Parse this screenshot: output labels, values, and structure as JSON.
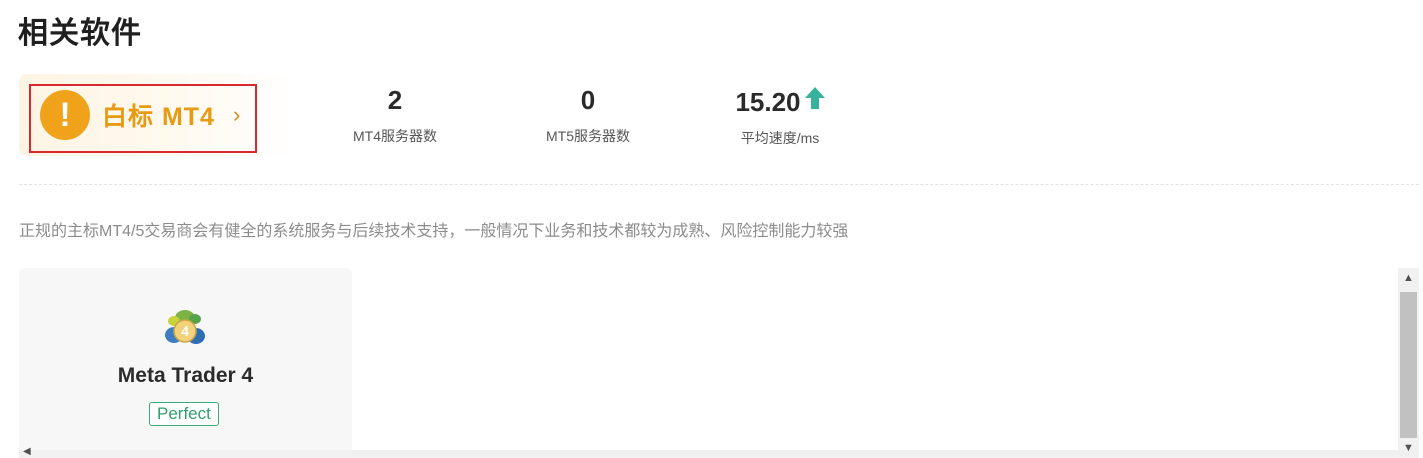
{
  "section": {
    "title": "相关软件"
  },
  "license": {
    "label": "白标 MT4",
    "icon": "warning-icon",
    "chevron": "chevron-right-icon",
    "highlight_color": "#d9292f",
    "accent": "#f0a21a"
  },
  "stats": [
    {
      "value": "2",
      "label": "MT4服务器数"
    },
    {
      "value": "0",
      "label": "MT5服务器数"
    },
    {
      "value": "15.20",
      "label": "平均速度/ms",
      "trend_icon": "arrow-up-icon",
      "trend_color": "#37b39b"
    }
  ],
  "description": "正规的主标MT4/5交易商会有健全的系统服务与后续技术支持，一般情况下业务和技术都较为成熟、风险控制能力较强",
  "software": [
    {
      "name": "Meta Trader 4",
      "badge": "Perfect",
      "logo": "mt4-logo-icon",
      "badge_color": "#3daa7b"
    }
  ],
  "scrollbar": {
    "up": "▲",
    "down": "▼",
    "left": "◀"
  }
}
